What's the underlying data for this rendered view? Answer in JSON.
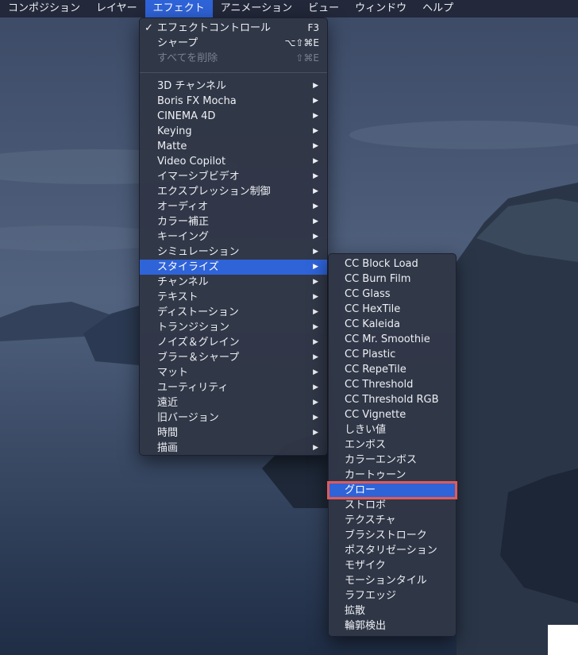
{
  "menubar": {
    "items": [
      "コンポジション",
      "レイヤー",
      "エフェクト",
      "アニメーション",
      "ビュー",
      "ウィンドウ",
      "ヘルプ"
    ]
  },
  "effect_menu": {
    "top_items": [
      {
        "label": "エフェクトコントロール",
        "shortcut": "F3",
        "checked": true,
        "enabled": true
      },
      {
        "label": "シャープ",
        "shortcut": "⌥⇧⌘E",
        "checked": false,
        "enabled": true
      },
      {
        "label": "すべてを削除",
        "shortcut": "⇧⌘E",
        "checked": false,
        "enabled": false
      }
    ],
    "check_glyph": "✓",
    "arrow_glyph": "▶",
    "categories": [
      "3D チャンネル",
      "Boris FX Mocha",
      "CINEMA 4D",
      "Keying",
      "Matte",
      "Video Copilot",
      "イマーシブビデオ",
      "エクスプレッション制御",
      "オーディオ",
      "カラー補正",
      "キーイング",
      "シミュレーション",
      "スタイライズ",
      "チャンネル",
      "テキスト",
      "ディストーション",
      "トランジション",
      "ノイズ＆グレイン",
      "ブラー＆シャープ",
      "マット",
      "ユーティリティ",
      "遠近",
      "旧バージョン",
      "時間",
      "描画"
    ],
    "highlighted_category": "スタイライズ"
  },
  "stylize_submenu": {
    "items": [
      "CC Block Load",
      "CC Burn Film",
      "CC Glass",
      "CC HexTile",
      "CC Kaleida",
      "CC Mr. Smoothie",
      "CC Plastic",
      "CC RepeTile",
      "CC Threshold",
      "CC Threshold RGB",
      "CC Vignette",
      "しきい値",
      "エンボス",
      "カラーエンボス",
      "カートゥーン",
      "グロー",
      "ストロボ",
      "テクスチャ",
      "ブラシストローク",
      "ポスタリゼーション",
      "モザイク",
      "モーションタイル",
      "ラフエッジ",
      "拡散",
      "輪郭検出"
    ],
    "highlighted_item": "グロー"
  },
  "colors": {
    "menubar_bg": "#23283a",
    "menu_bg": "#303646",
    "highlight": "#2f63d8",
    "outline": "#e05a5a"
  }
}
